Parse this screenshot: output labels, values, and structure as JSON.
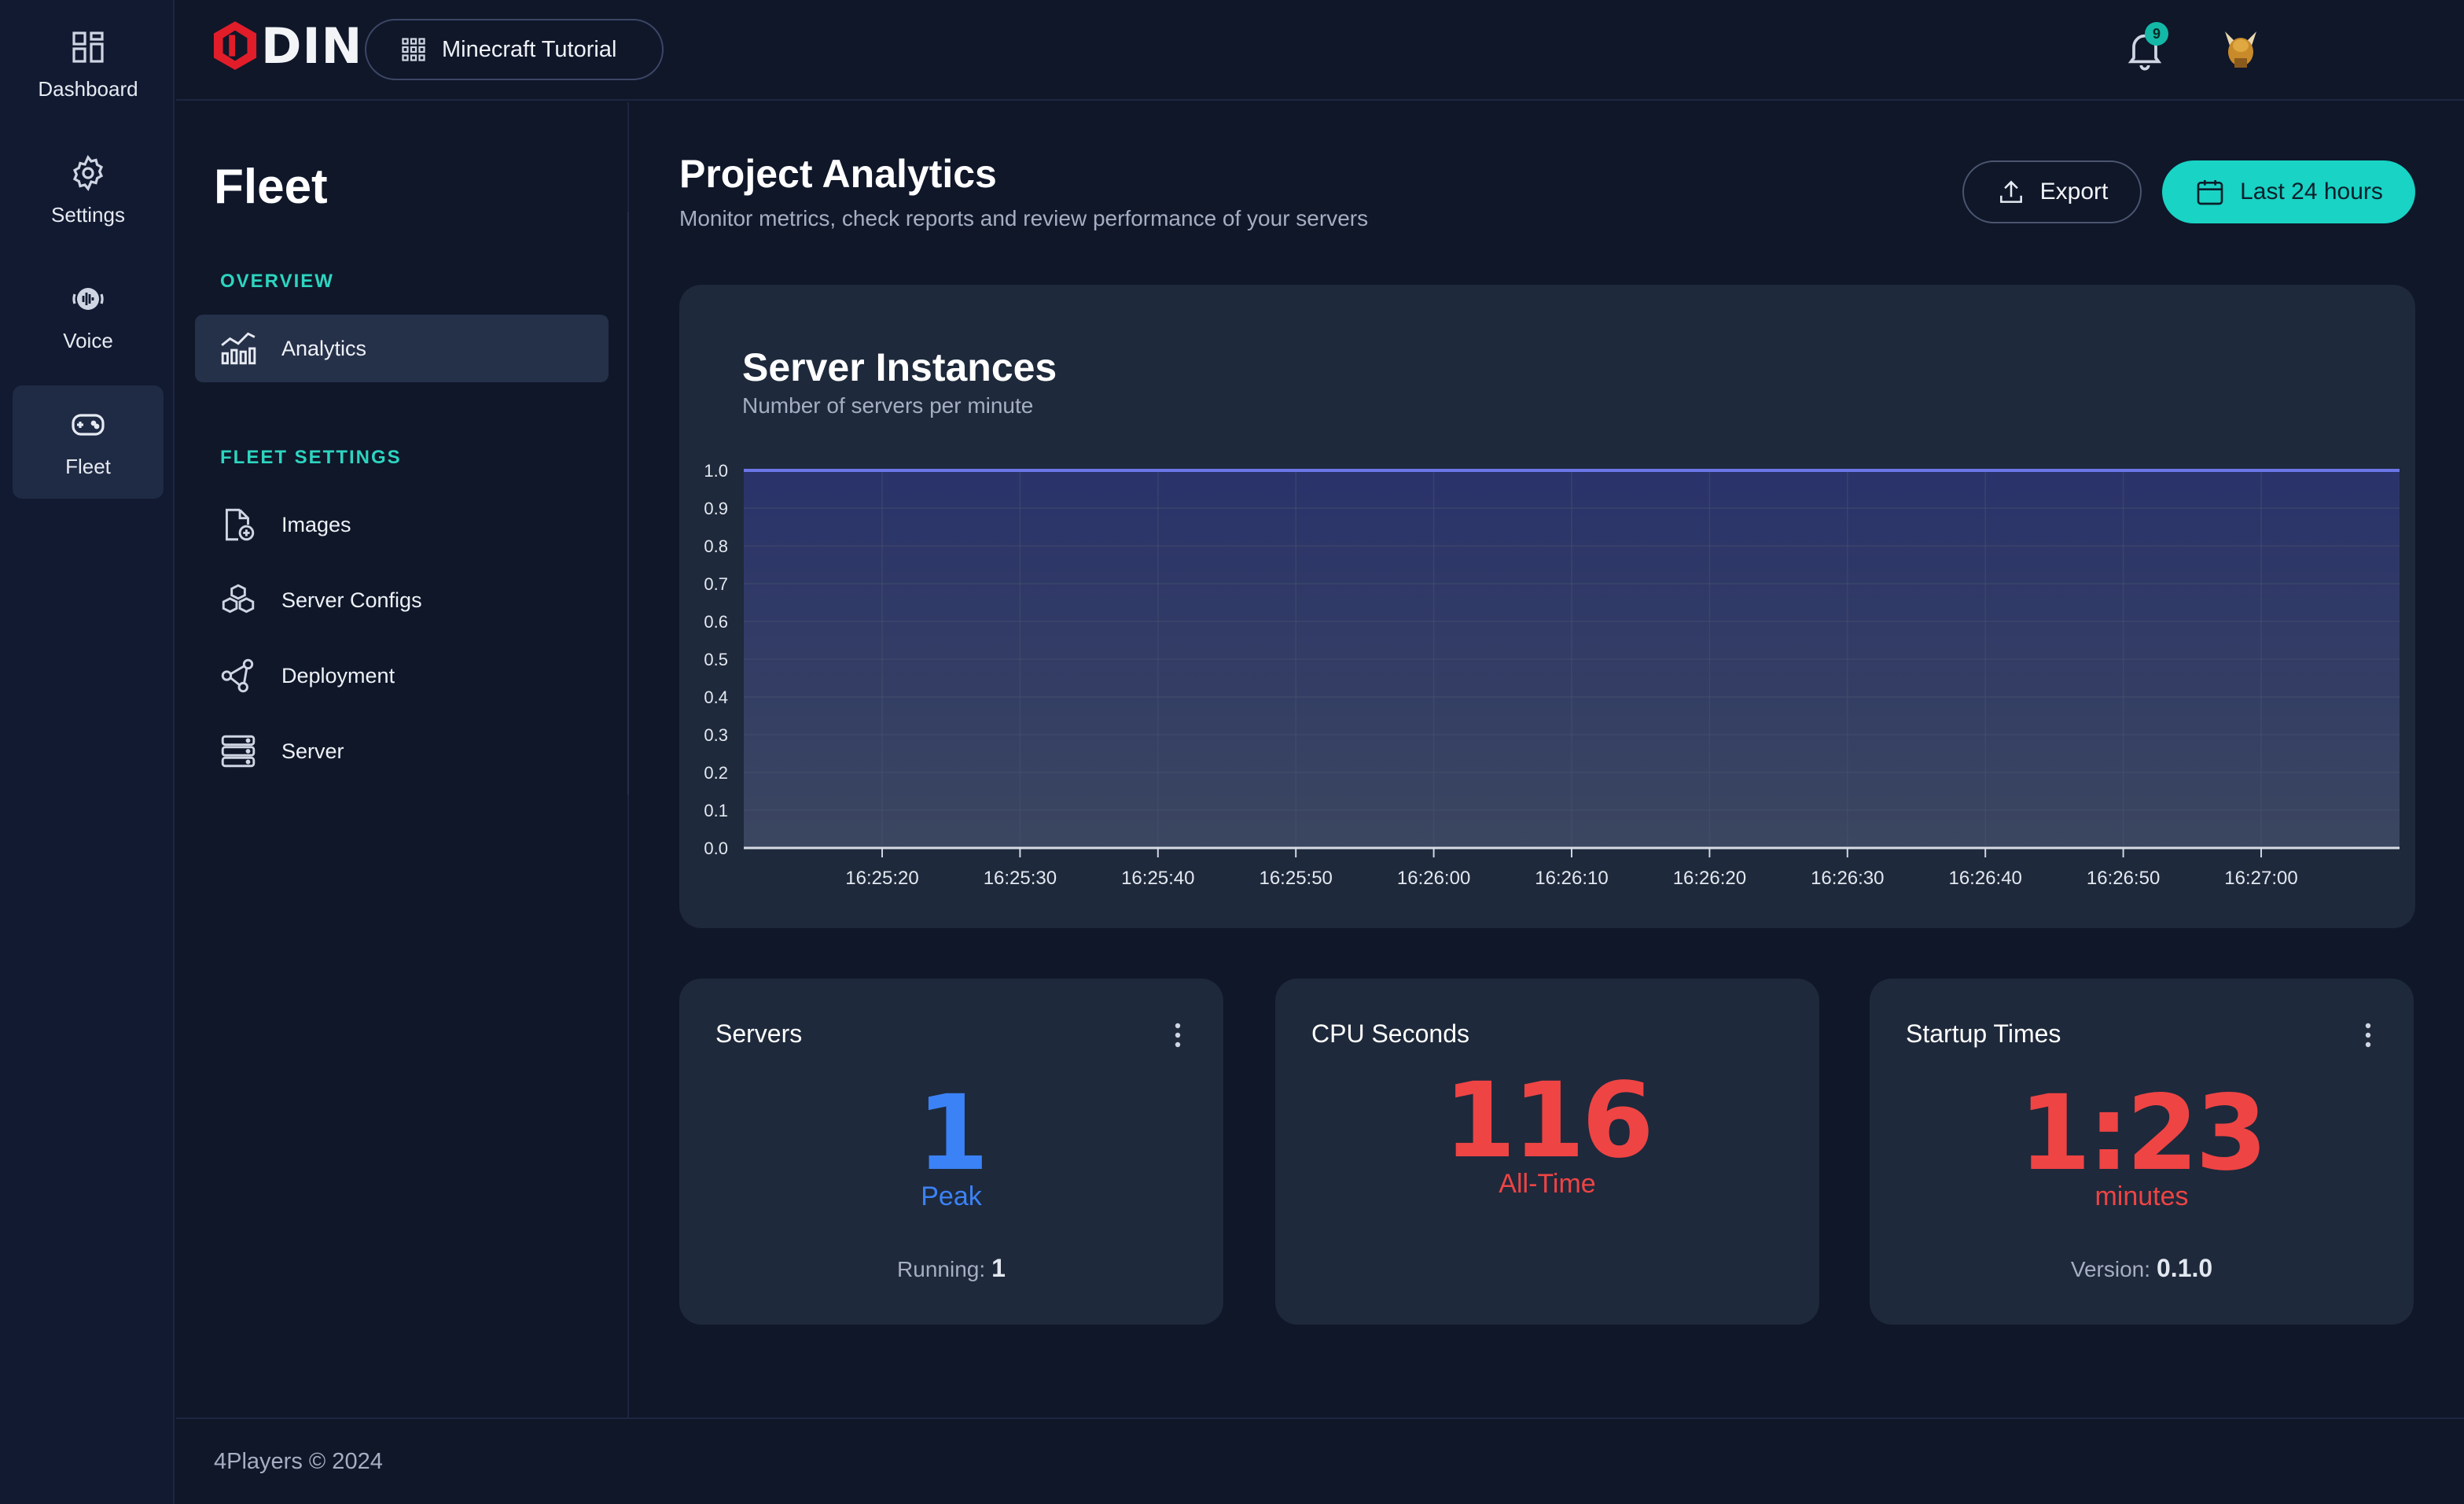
{
  "rail": {
    "items": [
      {
        "label": "Dashboard",
        "icon": "dashboard-icon"
      },
      {
        "label": "Settings",
        "icon": "gear-icon"
      },
      {
        "label": "Voice",
        "icon": "voice-icon"
      },
      {
        "label": "Fleet",
        "icon": "gamepad-icon",
        "active": true
      }
    ]
  },
  "topbar": {
    "logo_text": "DIN",
    "project_name": "Minecraft Tutorial",
    "notification_count": "9"
  },
  "sidebar": {
    "title": "Fleet",
    "overview_heading": "OVERVIEW",
    "overview_items": [
      {
        "label": "Analytics",
        "icon": "analytics-icon",
        "active": true
      }
    ],
    "settings_heading": "FLEET SETTINGS",
    "settings_items": [
      {
        "label": "Images",
        "icon": "image-file-icon"
      },
      {
        "label": "Server Configs",
        "icon": "cubes-icon"
      },
      {
        "label": "Deployment",
        "icon": "share-nodes-icon"
      },
      {
        "label": "Server",
        "icon": "server-icon"
      }
    ]
  },
  "main": {
    "title": "Project Analytics",
    "subtitle": "Monitor metrics, check reports and review performance of your servers",
    "export_label": "Export",
    "range_label": "Last 24 hours"
  },
  "chart_data": {
    "type": "area",
    "title": "Server Instances",
    "subtitle": "Number of servers per minute",
    "x": [
      "16:25:20",
      "16:25:30",
      "16:25:40",
      "16:25:50",
      "16:26:00",
      "16:26:10",
      "16:26:20",
      "16:26:30",
      "16:26:40",
      "16:26:50",
      "16:27:00"
    ],
    "series": [
      {
        "values": [
          1,
          1,
          1,
          1,
          1,
          1,
          1,
          1,
          1,
          1,
          1
        ]
      }
    ],
    "yticks": [
      "0.0",
      "0.1",
      "0.2",
      "0.3",
      "0.4",
      "0.5",
      "0.6",
      "0.7",
      "0.8",
      "0.9",
      "1.0"
    ],
    "ylim": [
      0,
      1
    ],
    "grid": true,
    "line_color": "#6b76e8"
  },
  "stats": [
    {
      "title": "Servers",
      "value": "1",
      "unit": "Peak",
      "foot_label": "Running:",
      "foot_value": "1",
      "color": "#3b82f6"
    },
    {
      "title": "CPU Seconds",
      "value": "116",
      "unit": "All-Time",
      "color": "#ef4444"
    },
    {
      "title": "Startup Times",
      "value": "1:23",
      "unit": "minutes",
      "foot_label": "Version:",
      "foot_value": "0.1.0",
      "color": "#ef4444"
    }
  ],
  "footer": {
    "text": "4Players © 2024"
  }
}
